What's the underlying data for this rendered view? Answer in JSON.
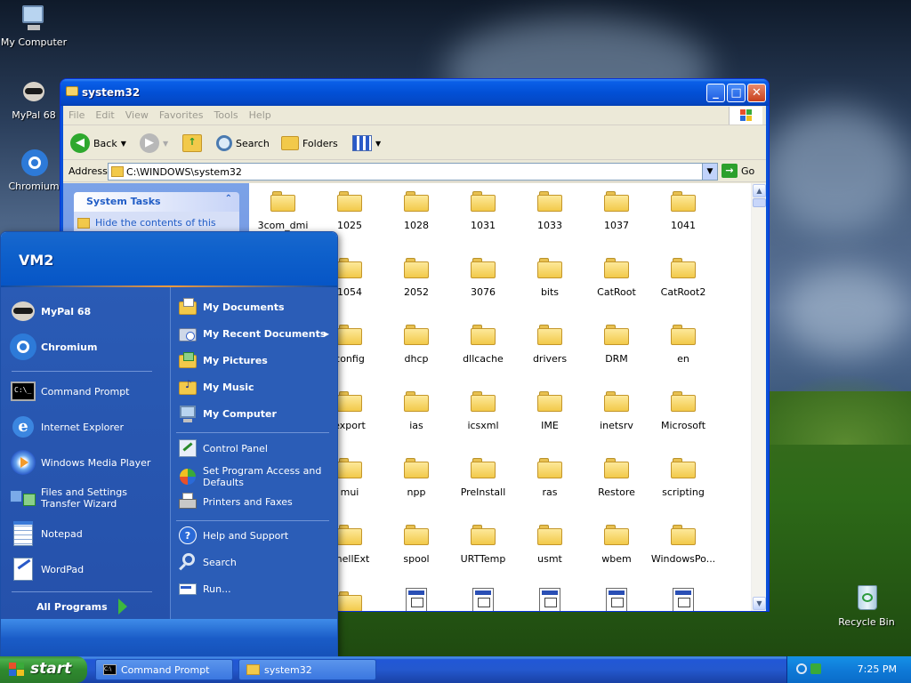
{
  "desktop": {
    "icons": [
      {
        "label": "My Computer"
      },
      {
        "label": "MyPal 68"
      },
      {
        "label": "Chromium"
      },
      {
        "label": "Recycle Bin"
      }
    ]
  },
  "explorer": {
    "title": "system32",
    "menu": [
      "File",
      "Edit",
      "View",
      "Favorites",
      "Tools",
      "Help"
    ],
    "toolbar": {
      "back": "Back",
      "search": "Search",
      "folders": "Folders"
    },
    "address": {
      "label": "Address",
      "value": "C:\\WINDOWS\\system32",
      "go": "Go"
    },
    "task_pane": {
      "title": "System Tasks",
      "item": "Hide the contents of this"
    },
    "items": [
      "3com_dmi",
      "1025",
      "1028",
      "1031",
      "1033",
      "1037",
      "1041",
      "",
      "1054",
      "2052",
      "3076",
      "bits",
      "CatRoot",
      "CatRoot2",
      "",
      "config",
      "dhcp",
      "dllcache",
      "drivers",
      "DRM",
      "en",
      "",
      "export",
      "ias",
      "icsxml",
      "IME",
      "inetsrv",
      "Microsoft",
      "",
      "mui",
      "npp",
      "PreInstall",
      "ras",
      "Restore",
      "scripting",
      "",
      "ShellExt",
      "spool",
      "URTTemp",
      "usmt",
      "wbem",
      "WindowsPo..."
    ]
  },
  "start_menu": {
    "user": "VM2",
    "pinned": [
      "MyPal 68",
      "Chromium"
    ],
    "recent": [
      "Command Prompt",
      "Internet Explorer",
      "Windows Media Player",
      "Files and Settings Transfer Wizard",
      "Notepad",
      "WordPad"
    ],
    "all_programs": "All Programs",
    "right_top": [
      "My Documents",
      "My Recent Documents",
      "My Pictures",
      "My Music",
      "My Computer"
    ],
    "right_mid": [
      "Control Panel",
      "Set Program Access and Defaults",
      "Printers and Faxes"
    ],
    "right_bottom": [
      "Help and Support",
      "Search",
      "Run..."
    ]
  },
  "taskbar": {
    "start": "start",
    "tasks": [
      "Command Prompt",
      "system32"
    ],
    "clock": "7:25 PM"
  },
  "colors": {
    "accent": "#0a5fe8",
    "start_green": "#3c8a3c",
    "menu_blue": "#2b5db7"
  }
}
